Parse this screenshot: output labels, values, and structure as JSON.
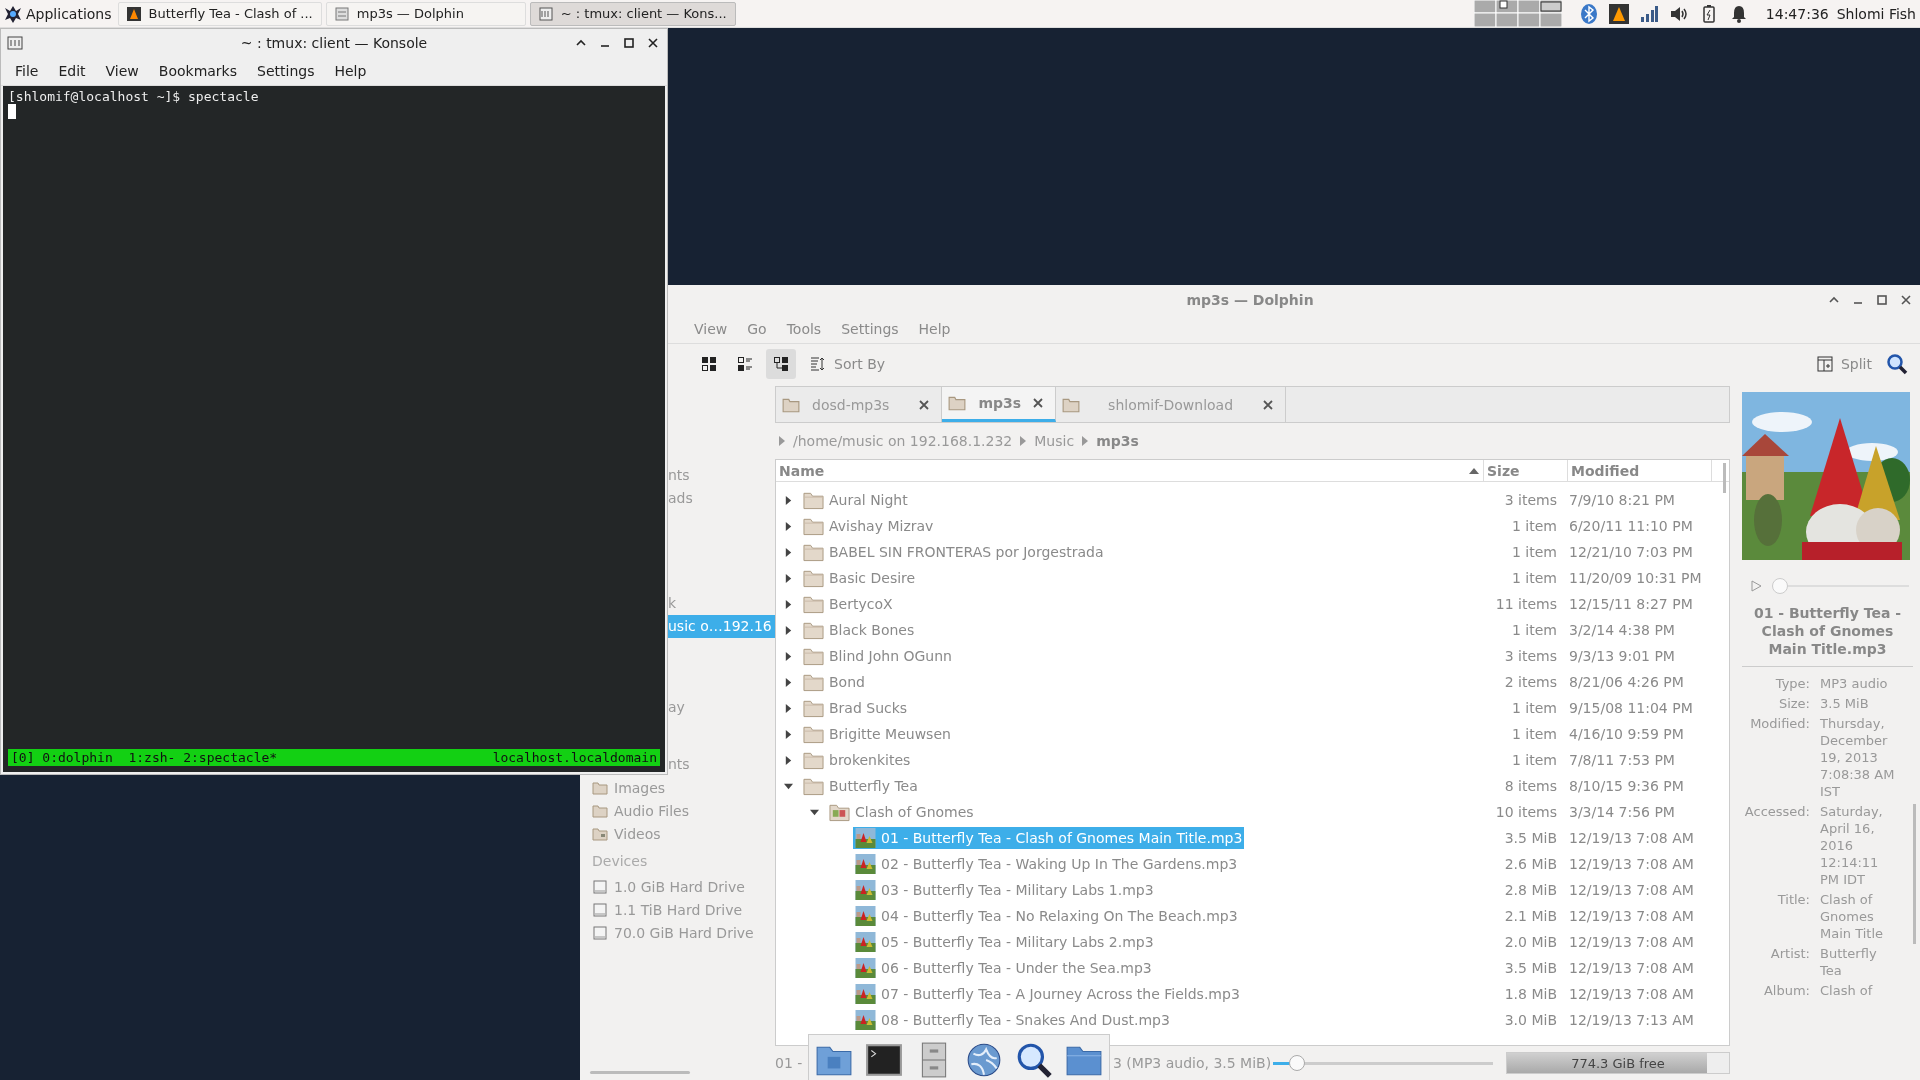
{
  "taskbar": {
    "launcher": "Applications",
    "tasks": [
      {
        "title": "Butterfly Tea - Clash of ...",
        "kind": "player",
        "selected": false
      },
      {
        "title": "mp3s — Dolphin",
        "kind": "files",
        "selected": false
      },
      {
        "title": "~ : tmux: client — Kons...",
        "kind": "terminal",
        "selected": true
      }
    ],
    "clock": "14:47:36",
    "user": "Shlomi Fish"
  },
  "konsole": {
    "title": "~ : tmux: client — Konsole",
    "menu": [
      "File",
      "Edit",
      "View",
      "Bookmarks",
      "Settings",
      "Help"
    ],
    "lines": [
      "[shlomif@localhost ~]$ spectacle"
    ],
    "status_left": "[0] 0:dolphin  1:zsh- 2:spectacle*",
    "status_right": "localhost.localdomain"
  },
  "dolphin": {
    "title": "mp3s — Dolphin",
    "menu": [
      "View",
      "Go",
      "Tools",
      "Settings",
      "Help"
    ],
    "view_modes": [
      {
        "kind": "icons",
        "selected": false
      },
      {
        "kind": "compact",
        "selected": false
      },
      {
        "kind": "details",
        "selected": true
      }
    ],
    "sort_label": "Sort By",
    "split_label": "Split",
    "places": [
      {
        "label": "nts",
        "selected": false
      },
      {
        "label": "ads",
        "selected": false
      },
      {
        "label": "k",
        "selected": false
      },
      {
        "label": "usic o…192.16",
        "selected": true
      },
      {
        "label": "ay",
        "selected": false
      },
      {
        "label": "nts",
        "selected": false
      }
    ],
    "folders": [
      {
        "label": "Images",
        "kind": "folder"
      },
      {
        "label": "Audio Files",
        "kind": "folder"
      },
      {
        "label": "Videos",
        "kind": "video"
      }
    ],
    "devices_heading": "Devices",
    "devices": [
      "1.0 GiB Hard Drive",
      "1.1 TiB Hard Drive",
      "70.0 GiB Hard Drive"
    ],
    "tabs": [
      {
        "label": "dosd-mp3s",
        "selected": false
      },
      {
        "label": "mp3s",
        "selected": true
      },
      {
        "label": "shlomif-Download",
        "selected": false
      }
    ],
    "breadcrumb": [
      "/home/music on 192.168.1.232",
      "Music",
      "mp3s"
    ],
    "columns": [
      {
        "label": "Name",
        "sorted": true
      },
      {
        "label": "Size",
        "sorted": false
      },
      {
        "label": "Modified",
        "sorted": false
      }
    ],
    "rows": [
      {
        "name": "Aural Night",
        "kind": "folder",
        "expanded": false,
        "selected": false,
        "size": "3 items",
        "modified": "7/9/10 8:21 PM"
      },
      {
        "name": "Avishay Mizrav",
        "kind": "folder",
        "expanded": false,
        "selected": false,
        "size": "1 item",
        "modified": "6/20/11 11:10 PM"
      },
      {
        "name": "BABEL SIN FRONTERAS por Jorgestrada",
        "kind": "folder",
        "expanded": false,
        "selected": false,
        "size": "1 item",
        "modified": "12/21/10 7:03 PM"
      },
      {
        "name": "Basic Desire",
        "kind": "folder",
        "expanded": false,
        "selected": false,
        "size": "1 item",
        "modified": "11/20/09 10:31 PM"
      },
      {
        "name": "BertycoX",
        "kind": "folder",
        "expanded": false,
        "selected": false,
        "size": "11 items",
        "modified": "12/15/11 8:27 PM"
      },
      {
        "name": "Black Bones",
        "kind": "folder",
        "expanded": false,
        "selected": false,
        "size": "1 item",
        "modified": "3/2/14 4:38 PM"
      },
      {
        "name": "Blind John OGunn",
        "kind": "folder",
        "expanded": false,
        "selected": false,
        "size": "3 items",
        "modified": "9/3/13 9:01 PM"
      },
      {
        "name": "Bond",
        "kind": "folder",
        "expanded": false,
        "selected": false,
        "size": "2 items",
        "modified": "8/21/06 4:26 PM"
      },
      {
        "name": "Brad Sucks",
        "kind": "folder",
        "expanded": false,
        "selected": false,
        "size": "1 item",
        "modified": "9/15/08 11:04 PM"
      },
      {
        "name": "Brigitte Meuwsen",
        "kind": "folder",
        "expanded": false,
        "selected": false,
        "size": "1 item",
        "modified": "4/16/10 9:59 PM"
      },
      {
        "name": "brokenkites",
        "kind": "folder",
        "expanded": false,
        "selected": false,
        "size": "1 item",
        "modified": "7/8/11 7:53 PM"
      },
      {
        "name": "Butterfly Tea",
        "kind": "folder",
        "expanded": true,
        "selected": false,
        "size": "8 items",
        "modified": "8/10/15 9:36 PM",
        "children": [
          {
            "name": "Clash of Gnomes",
            "kind": "album",
            "expanded": true,
            "selected": false,
            "size": "10 items",
            "modified": "3/3/14 7:56 PM",
            "children": [
              {
                "name": "01 - Butterfly Tea - Clash of Gnomes Main Title.mp3",
                "kind": "track",
                "selected": true,
                "size": "3.5 MiB",
                "modified": "12/19/13 7:08 AM"
              },
              {
                "name": "02 - Butterfly Tea - Waking Up In The Gardens.mp3",
                "kind": "track",
                "selected": false,
                "size": "2.6 MiB",
                "modified": "12/19/13 7:08 AM"
              },
              {
                "name": "03 - Butterfly Tea - Military Labs 1.mp3",
                "kind": "track",
                "selected": false,
                "size": "2.8 MiB",
                "modified": "12/19/13 7:08 AM"
              },
              {
                "name": "04 - Butterfly Tea - No Relaxing On The Beach.mp3",
                "kind": "track",
                "selected": false,
                "size": "2.1 MiB",
                "modified": "12/19/13 7:08 AM"
              },
              {
                "name": "05 - Butterfly Tea - Military Labs 2.mp3",
                "kind": "track",
                "selected": false,
                "size": "2.0 MiB",
                "modified": "12/19/13 7:08 AM"
              },
              {
                "name": "06 - Butterfly Tea - Under the Sea.mp3",
                "kind": "track",
                "selected": false,
                "size": "3.5 MiB",
                "modified": "12/19/13 7:08 AM"
              },
              {
                "name": "07 - Butterfly Tea - A Journey Across the Fields.mp3",
                "kind": "track",
                "selected": false,
                "size": "1.8 MiB",
                "modified": "12/19/13 7:08 AM"
              },
              {
                "name": "08 - Butterfly Tea - Snakes And Dust.mp3",
                "kind": "track",
                "selected": false,
                "size": "3.0 MiB",
                "modified": "12/19/13 7:13 AM"
              }
            ]
          }
        ]
      }
    ],
    "status": {
      "left": "01 -",
      "right": "3 (MP3 audio, 3.5 MiB)",
      "zoom": {
        "level": 0.08
      },
      "free_space": {
        "text": "774.3 GiB free",
        "level": 0.9
      }
    },
    "info": {
      "player": {
        "level": 0
      },
      "title": "01 - Butterfly Tea - Clash of Gnomes Main Title.mp3",
      "fields": [
        {
          "label": "Type:",
          "value": "MP3 audio"
        },
        {
          "label": "Size:",
          "value": "3.5 MiB"
        },
        {
          "label": "Modified:",
          "value": "Thursday, December 19, 2013 7:08:38 AM IST"
        },
        {
          "label": "Accessed:",
          "value": "Saturday, April 16, 2016 12:14:11 PM IDT"
        },
        {
          "label": "Title:",
          "value": "Clash of Gnomes Main Title"
        },
        {
          "label": "Artist:",
          "value": "Butterfly Tea"
        },
        {
          "label": "Album:",
          "value": "Clash of"
        }
      ]
    }
  }
}
